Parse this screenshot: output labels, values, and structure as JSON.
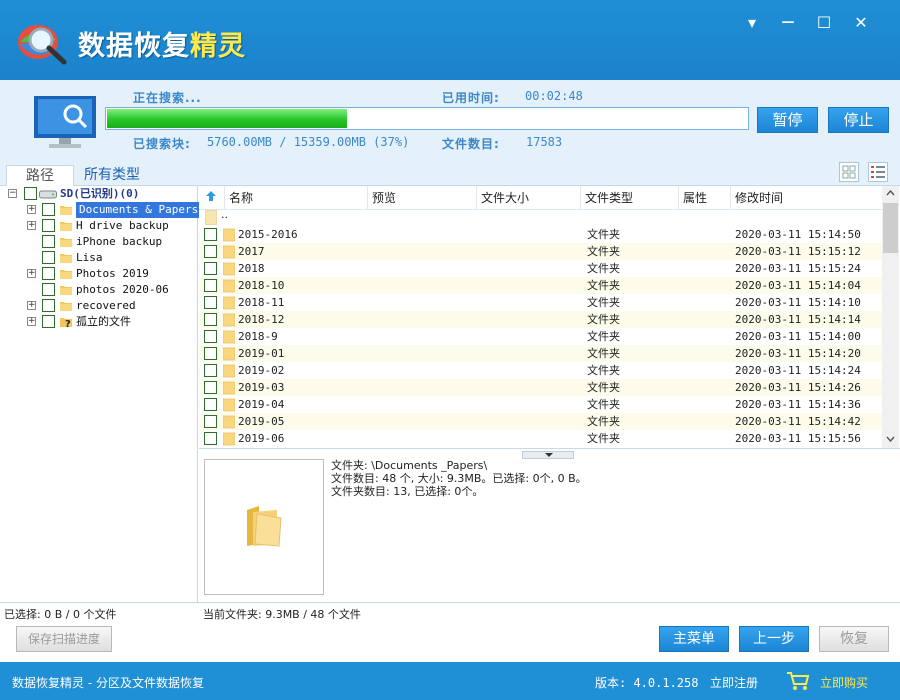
{
  "window": {
    "title_main": "数据恢复",
    "title_highlight": "精灵",
    "controls": {
      "menu": "▾",
      "minimize": "—",
      "maximize": "☐",
      "close": "✕"
    }
  },
  "status": {
    "searching_label": "正在搜索...",
    "elapsed_label": "已用时间:",
    "elapsed_value": "00:02:48",
    "searched_label": "已搜索块:",
    "searched_value": "5760.00MB / 15359.00MB (37%)",
    "progress_fraction": 0.375,
    "file_count_label": "文件数目:",
    "file_count_value": "17583",
    "pause_button": "暂停",
    "stop_button": "停止"
  },
  "tabs": {
    "path": "路径",
    "all_types": "所有类型"
  },
  "tree": {
    "root": "SD(已识别)(0)",
    "items": [
      {
        "label": "Documents & Papers",
        "expandable": true,
        "selected": true
      },
      {
        "label": "H drive backup",
        "expandable": true,
        "selected": false
      },
      {
        "label": "iPhone backup",
        "expandable": false,
        "selected": false
      },
      {
        "label": "Lisa",
        "expandable": false,
        "selected": false
      },
      {
        "label": "Photos 2019",
        "expandable": true,
        "selected": false
      },
      {
        "label": "photos 2020-06",
        "expandable": false,
        "selected": false
      },
      {
        "label": "recovered",
        "expandable": true,
        "selected": false
      },
      {
        "label": "孤立的文件",
        "expandable": true,
        "selected": false
      }
    ]
  },
  "file_list": {
    "headers": {
      "name": "名称",
      "preview": "预览",
      "size": "文件大小",
      "type": "文件类型",
      "attr": "属性",
      "modified": "修改时间"
    },
    "parent_row": "..",
    "rows": [
      {
        "name": "2015-2016",
        "type": "文件夹",
        "modified": "2020-03-11 15:14:50"
      },
      {
        "name": "2017",
        "type": "文件夹",
        "modified": "2020-03-11 15:15:12"
      },
      {
        "name": "2018",
        "type": "文件夹",
        "modified": "2020-03-11 15:15:24"
      },
      {
        "name": "2018-10",
        "type": "文件夹",
        "modified": "2020-03-11 15:14:04"
      },
      {
        "name": "2018-11",
        "type": "文件夹",
        "modified": "2020-03-11 15:14:10"
      },
      {
        "name": "2018-12",
        "type": "文件夹",
        "modified": "2020-03-11 15:14:14"
      },
      {
        "name": "2018-9",
        "type": "文件夹",
        "modified": "2020-03-11 15:14:00"
      },
      {
        "name": "2019-01",
        "type": "文件夹",
        "modified": "2020-03-11 15:14:20"
      },
      {
        "name": "2019-02",
        "type": "文件夹",
        "modified": "2020-03-11 15:14:24"
      },
      {
        "name": "2019-03",
        "type": "文件夹",
        "modified": "2020-03-11 15:14:26"
      },
      {
        "name": "2019-04",
        "type": "文件夹",
        "modified": "2020-03-11 15:14:36"
      },
      {
        "name": "2019-05",
        "type": "文件夹",
        "modified": "2020-03-11 15:14:42"
      },
      {
        "name": "2019-06",
        "type": "文件夹",
        "modified": "2020-03-11 15:15:56"
      }
    ]
  },
  "info": {
    "line1": "文件夹: \\Documents _Papers\\",
    "line2": "文件数目: 48 个, 大小: 9.3MB。已选择: 0个, 0 B。",
    "line3": "文件夹数目: 13, 已选择: 0个。"
  },
  "strip": {
    "selected": "已选择: 0 B / 0 个文件",
    "current_folder": "当前文件夹: 9.3MB / 48 个文件"
  },
  "buttons": {
    "save_progress": "保存扫描进度",
    "main_menu": "主菜单",
    "back": "上一步",
    "recover": "恢复"
  },
  "footer": {
    "app_desc": "数据恢复精灵 - 分区及文件数据恢复",
    "version": "版本: 4.0.1.258",
    "register": "立即注册",
    "buy": "立即购买"
  },
  "colors": {
    "brand_blue": "#1f8fd6",
    "status_text": "#3c87c9",
    "progress_green": "#29c629",
    "buy_yellow": "#ffe94d"
  }
}
